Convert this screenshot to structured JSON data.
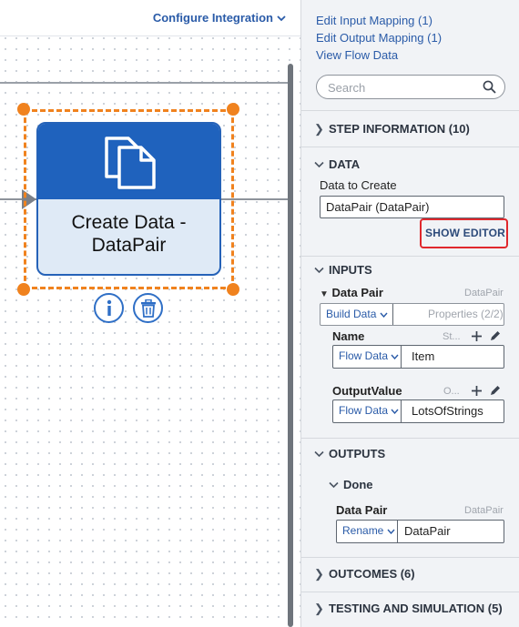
{
  "canvas": {
    "configure_label": "Configure Integration",
    "node": {
      "title": "Create Data -\nDataPair"
    }
  },
  "panel": {
    "links": [
      "Edit Input Mapping (1)",
      "Edit Output Mapping (1)",
      "View Flow Data"
    ],
    "search_placeholder": "Search",
    "sections": {
      "step_information": "STEP INFORMATION (10)",
      "data": "DATA",
      "inputs": "INPUTS",
      "outputs": "OUTPUTS",
      "outcomes": "OUTCOMES (6)",
      "testing": "TESTING AND SIMULATION (5)"
    },
    "data": {
      "label": "Data to Create",
      "value": "DataPair (DataPair)",
      "show_editor": "SHOW EDITOR"
    },
    "inputs": {
      "data_pair_label": "Data Pair",
      "data_pair_type": "DataPair",
      "build_data": "Build Data",
      "properties": "Properties (2/2)",
      "name_label": "Name",
      "name_type": "St...",
      "name_source": "Flow Data",
      "name_value": "Item",
      "output_label": "OutputValue",
      "output_type": "O...",
      "output_source": "Flow Data",
      "output_value": "LotsOfStrings"
    },
    "outputs": {
      "done_label": "Done",
      "data_pair_label": "Data Pair",
      "data_pair_type": "DataPair",
      "rename": "Rename",
      "value": "DataPair"
    }
  },
  "colors": {
    "accent_blue": "#2a5ba8",
    "node_blue": "#1f62bd",
    "selection_orange": "#f0821e",
    "highlight_red": "#e0282d"
  }
}
